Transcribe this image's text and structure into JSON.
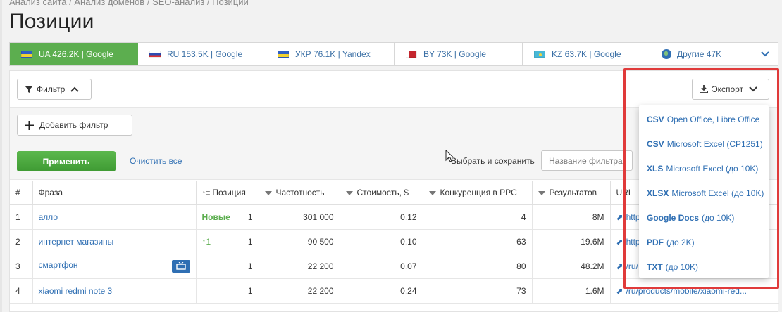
{
  "breadcrumb": [
    "Анализ сайта",
    "Анализ доменов",
    "SEO-анализ",
    "Позиции"
  ],
  "page_title": "Позиции",
  "tabs": [
    {
      "flag": "ua",
      "label": "UA 426.2K | Google",
      "active": true
    },
    {
      "flag": "ru",
      "label": "RU 153.5K | Google"
    },
    {
      "flag": "ua",
      "label": "УКР 76.1K | Yandex"
    },
    {
      "flag": "by",
      "label": "BY 73K | Google"
    },
    {
      "flag": "kz",
      "label": "KZ 63.7K | Google"
    },
    {
      "flag": "globe",
      "label": "Другие 47K"
    }
  ],
  "toolbar": {
    "filter_label": "Фильтр",
    "export_label": "Экспорт",
    "add_filter_label": "Добавить фильтр",
    "apply_label": "Применить",
    "clear_label": "Очистить все",
    "select_save_label": "Выбрать и сохранить",
    "filter_name_placeholder": "Название фильтра"
  },
  "table": {
    "headers": [
      "#",
      "Фраза",
      "Позиция",
      "Частотность",
      "Стоимость, $",
      "Конкуренция в PPC",
      "Результатов",
      "URL"
    ],
    "rows": [
      {
        "n": "1",
        "phrase": "алло",
        "pos_tag": "Новые",
        "pos": "1",
        "freq": "301 000",
        "cost": "0.12",
        "ppc": "4",
        "results": "8M",
        "url": "http"
      },
      {
        "n": "2",
        "phrase": "интернет магазины",
        "pos_tag": "↑1",
        "pos": "1",
        "freq": "90 500",
        "cost": "0.10",
        "ppc": "63",
        "results": "19.6M",
        "url": "http"
      },
      {
        "n": "3",
        "phrase": "смартфон",
        "pos_tag": "",
        "pos": "1",
        "freq": "22 200",
        "cost": "0.07",
        "ppc": "80",
        "results": "48.2M",
        "url": "/ru/"
      },
      {
        "n": "4",
        "phrase": "xiaomi redmi note 3",
        "pos_tag": "",
        "pos": "1",
        "freq": "22 200",
        "cost": "0.24",
        "ppc": "73",
        "results": "1.6M",
        "url": "/ru/products/mobile/xiaomi-red..."
      }
    ]
  },
  "export_menu": [
    {
      "format": "CSV",
      "desc": "Open Office, Libre Office"
    },
    {
      "format": "CSV",
      "desc": "Microsoft Excel (CP1251)"
    },
    {
      "format": "XLS",
      "desc": "Microsoft Excel (до 10K)"
    },
    {
      "format": "XLSX",
      "desc": "Microsoft Excel (до 10K)"
    },
    {
      "format": "Google Docs",
      "desc": "(до 10K)"
    },
    {
      "format": "PDF",
      "desc": "(до 2K)"
    },
    {
      "format": "TXT",
      "desc": "(до 10K)"
    }
  ],
  "colors": {
    "accent_green": "#5cae4f",
    "link_blue": "#2f6fb3",
    "highlight_red": "#e03a3a"
  }
}
